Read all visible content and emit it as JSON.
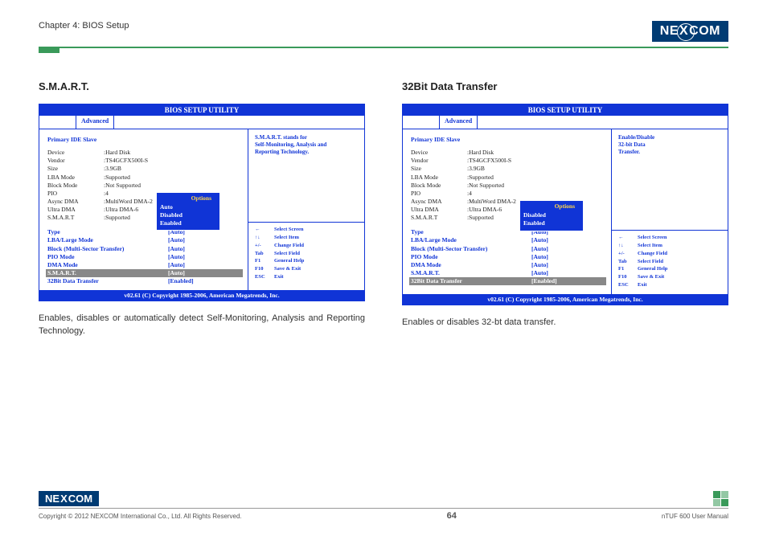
{
  "header": {
    "chapter": "Chapter 4: BIOS Setup",
    "brand_pre": "NE",
    "brand_x": "X",
    "brand_post": "COM"
  },
  "left": {
    "title": "S.M.A.R.T.",
    "bios_title": "BIOS SETUP UTILITY",
    "tab": "Advanced",
    "section": "Primary IDE Slave",
    "kv": [
      {
        "k": "Device",
        "v": ":Hard Disk"
      },
      {
        "k": "Vendor",
        "v": ":TS4GCFX500I-S"
      },
      {
        "k": "Size",
        "v": ":3.9GB"
      },
      {
        "k": "LBA Mode",
        "v": ":Supported"
      },
      {
        "k": "Block Mode",
        "v": ":Not Supported"
      },
      {
        "k": "PIO",
        "v": ":4"
      },
      {
        "k": "Async DMA",
        "v": ":MultiWord DMA-2"
      },
      {
        "k": "Ultra DMA",
        "v": ":Ultra DMA-6"
      },
      {
        "k": "S.M.A.R.T",
        "v": ":Supported"
      }
    ],
    "opts": [
      {
        "k": "Type",
        "v": "[Auto]"
      },
      {
        "k": "LBA/Large Mode",
        "v": "[Auto]"
      },
      {
        "k": "Block (Multi-Sector Transfer)",
        "v": "[Auto]"
      },
      {
        "k": "PIO Mode",
        "v": "[Auto]"
      },
      {
        "k": "DMA Mode",
        "v": "[Auto]"
      },
      {
        "k": "S.M.A.R.T.",
        "v": "[Auto]",
        "hl": true
      },
      {
        "k": "32Bit Data Transfer",
        "v": "[Enabled]"
      }
    ],
    "popup_title": "Options",
    "popup_items": [
      "Auto",
      "Disabled",
      "Enabled"
    ],
    "help_lines": [
      "S.M.A.R.T. stands for",
      "Self-Monitoring, Analysis and",
      "Reporting Technology."
    ],
    "nav": [
      {
        "k": "←",
        "v": "Select Screen"
      },
      {
        "k": "↑↓",
        "v": "Select Item"
      },
      {
        "k": "+/-",
        "v": "Change Field"
      },
      {
        "k": "Tab",
        "v": "Select Field"
      },
      {
        "k": "F1",
        "v": "General Help"
      },
      {
        "k": "F10",
        "v": "Save & Exit"
      },
      {
        "k": "ESC",
        "v": "Exit"
      }
    ],
    "copyright": "v02.61 (C) Copyright 1985-2006, American Megatrends, Inc.",
    "desc": "Enables, disables or automatically detect Self-Monitoring, Analysis and Reporting Technology."
  },
  "right": {
    "title": "32Bit Data Transfer",
    "bios_title": "BIOS SETUP UTILITY",
    "tab": "Advanced",
    "section": "Primary IDE Slave",
    "kv": [
      {
        "k": "Device",
        "v": ":Hard Disk"
      },
      {
        "k": "Vendor",
        "v": ":TS4GCFX500I-S"
      },
      {
        "k": "Size",
        "v": ":3.9GB"
      },
      {
        "k": "LBA Mode",
        "v": ":Supported"
      },
      {
        "k": "Block Mode",
        "v": ":Not Supported"
      },
      {
        "k": "PIO",
        "v": ":4"
      },
      {
        "k": "Async DMA",
        "v": ":MultiWord DMA-2"
      },
      {
        "k": "Ultra DMA",
        "v": ":Ultra DMA-6"
      },
      {
        "k": "S.M.A.R.T",
        "v": ":Supported"
      }
    ],
    "opts": [
      {
        "k": "Type",
        "v": "[Auto]"
      },
      {
        "k": "LBA/Large Mode",
        "v": "[Auto]"
      },
      {
        "k": "Block (Multi-Sector Transfer)",
        "v": "[Auto]"
      },
      {
        "k": "PIO Mode",
        "v": "[Auto]"
      },
      {
        "k": "DMA Mode",
        "v": "[Auto]"
      },
      {
        "k": "S.M.A.R.T.",
        "v": "[Auto]"
      },
      {
        "k": "32Bit Data Transfer",
        "v": "[Enabled]",
        "hl": true
      }
    ],
    "popup_title": "Options",
    "popup_items": [
      "Disabled",
      "Enabled"
    ],
    "help_lines": [
      "Enable/Disable",
      "32-bit Data",
      "Transfer."
    ],
    "nav": [
      {
        "k": "←",
        "v": "Select Screen"
      },
      {
        "k": "↑↓",
        "v": "Select Item"
      },
      {
        "k": "+/-",
        "v": "Change Field"
      },
      {
        "k": "Tab",
        "v": "Select Field"
      },
      {
        "k": "F1",
        "v": "General Help"
      },
      {
        "k": "F10",
        "v": "Save & Exit"
      },
      {
        "k": "ESC",
        "v": "Exit"
      }
    ],
    "copyright": "v02.61 (C) Copyright 1985-2006, American Megatrends, Inc.",
    "desc": "Enables or disables 32-bt data transfer."
  },
  "footer": {
    "copyright": "Copyright © 2012 NEXCOM International Co., Ltd. All Rights Reserved.",
    "page": "64",
    "manual": "nTUF 600 User Manual"
  }
}
